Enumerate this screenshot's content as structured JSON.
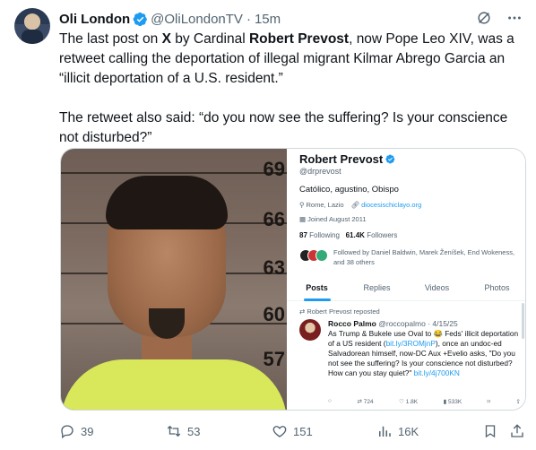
{
  "author": {
    "name": "Oli London",
    "handle": "@OliLondonTV",
    "separator": "·",
    "time": "15m"
  },
  "post": {
    "line1_pre": "The last post on ",
    "line1_x": "X",
    "line1_mid": " by Cardinal ",
    "line1_name": "Robert Prevost",
    "line1_post": ", now Pope Leo XIV, was a retweet calling the deportation of illegal migrant Kilmar Abrego Garcia an “illicit deportation of a U.S. resident.”",
    "line2": "The retweet also said: “do you now see the suffering? Is your conscience not disturbed?”"
  },
  "mugshot": {
    "height_marks": [
      "69",
      "66",
      "63",
      "60",
      "57"
    ]
  },
  "profile": {
    "name": "Robert Prevost",
    "handle": "@drprevost",
    "bio": "Católico, agustino, Obispo",
    "location": "Rome, Lazio",
    "website": "diocesischiclayo.org",
    "joined": "Joined August 2011",
    "following_count": "87",
    "following_label": "Following",
    "followers_count": "61.4K",
    "followers_label": "Followers",
    "followed_by": "Followed by Daniel Baldwin, Marek Ženíšek, End Wokeness, and 38 others",
    "tabs": [
      "Posts",
      "Replies",
      "Videos",
      "Photos"
    ],
    "repost_label": "Robert Prevost reposted",
    "retweet": {
      "name": "Rocco Palmo",
      "handle": "@roccopalmo",
      "date": "· 4/15/25",
      "text_a": "As Trump & Bukele use Oval to 😂 Feds' illicit deportation of a US resident (",
      "link1": "bit.ly/3ROMjnP",
      "text_b": "), once an undoc-ed Salvadorean himself, now-DC Aux +Evelio asks, \"Do you not see the suffering? Is your conscience not disturbed? How can you stay quiet?\" ",
      "link2": "bit.ly/4j700KN",
      "reposts": "724",
      "likes": "1.8K",
      "views": "533K"
    }
  },
  "actions": {
    "replies": "39",
    "reposts": "53",
    "likes": "151",
    "views": "16K"
  },
  "colors": {
    "accent": "#1d9bf0",
    "secondary_text": "#536471",
    "primary_text": "#0f1419",
    "border": "#cfd9de"
  },
  "icons": [
    "verified-badge-icon",
    "grok-icon",
    "more-icon",
    "reply-icon",
    "repost-icon",
    "like-icon",
    "views-icon",
    "bookmark-icon",
    "share-icon"
  ]
}
